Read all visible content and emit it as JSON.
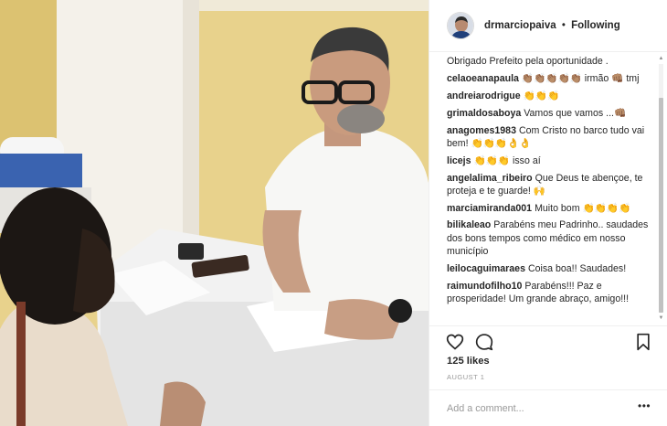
{
  "post": {
    "author": "drmarciopaiva",
    "separator": "•",
    "follow_status": "Following",
    "caption_tail": "Obrigado Prefeito pela oportunidade ."
  },
  "comments": [
    {
      "user": "celaoeanapaula",
      "text": "👏🏽👏🏽👏🏽👏🏽👏🏽 irmão 👊🏽 tmj"
    },
    {
      "user": "andreiarodrigue",
      "text": "👏👏👏"
    },
    {
      "user": "grimaldosaboya",
      "text": "Vamos que vamos ...👊🏽"
    },
    {
      "user": "anagomes1983",
      "text": "Com Cristo no barco tudo vai bem! 👏👏👏👌👌"
    },
    {
      "user": "licejs",
      "text": "👏👏👏 isso aí"
    },
    {
      "user": "angelalima_ribeiro",
      "text": "Que Deus te abençoe, te proteja e te guarde! 🙌"
    },
    {
      "user": "marciamiranda001",
      "text": "Muito bom 👏👏👏👏"
    },
    {
      "user": "bilikaleao",
      "text": "Parabéns meu Padrinho.. saudades dos bons tempos como médico em nosso município"
    },
    {
      "user": "leilocaguimaraes",
      "text": "Coisa boa!! Saudades!"
    },
    {
      "user": "raimundofilho10",
      "text": "Parabéns!!! Paz e prosperidade! Um grande abraço, amigo!!!"
    }
  ],
  "stats": {
    "likes": "125 likes",
    "date": "AUGUST 1"
  },
  "composer": {
    "placeholder": "Add a comment...",
    "more": "•••"
  },
  "icons": {
    "like": "heart-icon",
    "comment": "comment-bubble-icon",
    "save": "bookmark-icon",
    "more": "more-options-icon"
  },
  "colors": {
    "text": "#262626",
    "muted": "#999999",
    "border": "#efefef"
  }
}
